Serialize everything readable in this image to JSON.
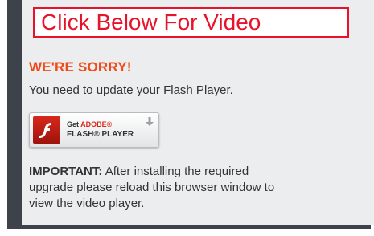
{
  "banner": {
    "text": "Click Below For Video"
  },
  "notice": {
    "heading": "WE'RE SORRY!",
    "message": "You need to update your Flash Player."
  },
  "flash_button": {
    "get_prefix": "Get ",
    "brand": "ADOBE®",
    "product": "FLASH® PLAYER",
    "icon": "adobe-flash-logo"
  },
  "important": {
    "label": "IMPORTANT:",
    "text": " After installing the required upgrade please reload this browser window to view the video player."
  },
  "colors": {
    "banner_red": "#e8132a",
    "heading_orange": "#f04b18",
    "frame_dark": "#3e434b",
    "panel_bg": "#ecedee"
  }
}
